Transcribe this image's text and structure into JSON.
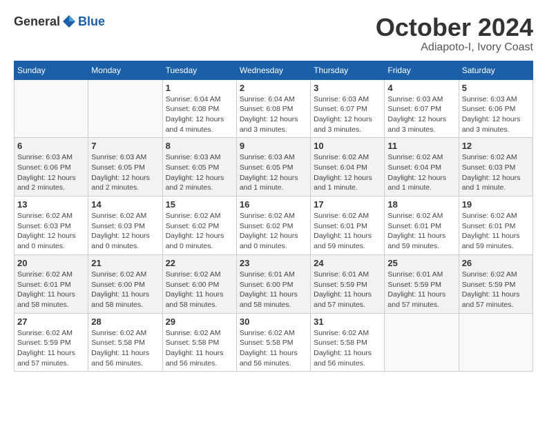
{
  "header": {
    "logo_general": "General",
    "logo_blue": "Blue",
    "month_title": "October 2024",
    "location": "Adiapoto-I, Ivory Coast"
  },
  "calendar": {
    "days_of_week": [
      "Sunday",
      "Monday",
      "Tuesday",
      "Wednesday",
      "Thursday",
      "Friday",
      "Saturday"
    ],
    "weeks": [
      [
        {
          "day": "",
          "info": ""
        },
        {
          "day": "",
          "info": ""
        },
        {
          "day": "1",
          "info": "Sunrise: 6:04 AM\nSunset: 6:08 PM\nDaylight: 12 hours and 4 minutes."
        },
        {
          "day": "2",
          "info": "Sunrise: 6:04 AM\nSunset: 6:08 PM\nDaylight: 12 hours and 3 minutes."
        },
        {
          "day": "3",
          "info": "Sunrise: 6:03 AM\nSunset: 6:07 PM\nDaylight: 12 hours and 3 minutes."
        },
        {
          "day": "4",
          "info": "Sunrise: 6:03 AM\nSunset: 6:07 PM\nDaylight: 12 hours and 3 minutes."
        },
        {
          "day": "5",
          "info": "Sunrise: 6:03 AM\nSunset: 6:06 PM\nDaylight: 12 hours and 3 minutes."
        }
      ],
      [
        {
          "day": "6",
          "info": "Sunrise: 6:03 AM\nSunset: 6:06 PM\nDaylight: 12 hours and 2 minutes."
        },
        {
          "day": "7",
          "info": "Sunrise: 6:03 AM\nSunset: 6:05 PM\nDaylight: 12 hours and 2 minutes."
        },
        {
          "day": "8",
          "info": "Sunrise: 6:03 AM\nSunset: 6:05 PM\nDaylight: 12 hours and 2 minutes."
        },
        {
          "day": "9",
          "info": "Sunrise: 6:03 AM\nSunset: 6:05 PM\nDaylight: 12 hours and 1 minute."
        },
        {
          "day": "10",
          "info": "Sunrise: 6:02 AM\nSunset: 6:04 PM\nDaylight: 12 hours and 1 minute."
        },
        {
          "day": "11",
          "info": "Sunrise: 6:02 AM\nSunset: 6:04 PM\nDaylight: 12 hours and 1 minute."
        },
        {
          "day": "12",
          "info": "Sunrise: 6:02 AM\nSunset: 6:03 PM\nDaylight: 12 hours and 1 minute."
        }
      ],
      [
        {
          "day": "13",
          "info": "Sunrise: 6:02 AM\nSunset: 6:03 PM\nDaylight: 12 hours and 0 minutes."
        },
        {
          "day": "14",
          "info": "Sunrise: 6:02 AM\nSunset: 6:03 PM\nDaylight: 12 hours and 0 minutes."
        },
        {
          "day": "15",
          "info": "Sunrise: 6:02 AM\nSunset: 6:02 PM\nDaylight: 12 hours and 0 minutes."
        },
        {
          "day": "16",
          "info": "Sunrise: 6:02 AM\nSunset: 6:02 PM\nDaylight: 12 hours and 0 minutes."
        },
        {
          "day": "17",
          "info": "Sunrise: 6:02 AM\nSunset: 6:01 PM\nDaylight: 11 hours and 59 minutes."
        },
        {
          "day": "18",
          "info": "Sunrise: 6:02 AM\nSunset: 6:01 PM\nDaylight: 11 hours and 59 minutes."
        },
        {
          "day": "19",
          "info": "Sunrise: 6:02 AM\nSunset: 6:01 PM\nDaylight: 11 hours and 59 minutes."
        }
      ],
      [
        {
          "day": "20",
          "info": "Sunrise: 6:02 AM\nSunset: 6:01 PM\nDaylight: 11 hours and 58 minutes."
        },
        {
          "day": "21",
          "info": "Sunrise: 6:02 AM\nSunset: 6:00 PM\nDaylight: 11 hours and 58 minutes."
        },
        {
          "day": "22",
          "info": "Sunrise: 6:02 AM\nSunset: 6:00 PM\nDaylight: 11 hours and 58 minutes."
        },
        {
          "day": "23",
          "info": "Sunrise: 6:01 AM\nSunset: 6:00 PM\nDaylight: 11 hours and 58 minutes."
        },
        {
          "day": "24",
          "info": "Sunrise: 6:01 AM\nSunset: 5:59 PM\nDaylight: 11 hours and 57 minutes."
        },
        {
          "day": "25",
          "info": "Sunrise: 6:01 AM\nSunset: 5:59 PM\nDaylight: 11 hours and 57 minutes."
        },
        {
          "day": "26",
          "info": "Sunrise: 6:02 AM\nSunset: 5:59 PM\nDaylight: 11 hours and 57 minutes."
        }
      ],
      [
        {
          "day": "27",
          "info": "Sunrise: 6:02 AM\nSunset: 5:59 PM\nDaylight: 11 hours and 57 minutes."
        },
        {
          "day": "28",
          "info": "Sunrise: 6:02 AM\nSunset: 5:58 PM\nDaylight: 11 hours and 56 minutes."
        },
        {
          "day": "29",
          "info": "Sunrise: 6:02 AM\nSunset: 5:58 PM\nDaylight: 11 hours and 56 minutes."
        },
        {
          "day": "30",
          "info": "Sunrise: 6:02 AM\nSunset: 5:58 PM\nDaylight: 11 hours and 56 minutes."
        },
        {
          "day": "31",
          "info": "Sunrise: 6:02 AM\nSunset: 5:58 PM\nDaylight: 11 hours and 56 minutes."
        },
        {
          "day": "",
          "info": ""
        },
        {
          "day": "",
          "info": ""
        }
      ]
    ]
  }
}
